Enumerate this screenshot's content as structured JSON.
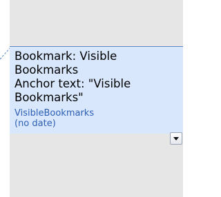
{
  "comment": {
    "text_lines": [
      "Bookmark: Visible",
      "Bookmarks",
      "Anchor text: \"Visible",
      "Bookmarks\""
    ],
    "author": "VisibleBookmarks",
    "date": "(no date)"
  },
  "icons": {
    "menu_button_icon": "triangle-down-icon"
  },
  "colors": {
    "panel_background": "#e6e6e6",
    "comment_background": "#d8e7fc",
    "comment_border": "#5b87c7",
    "author_text": "#2d5fb5",
    "connector_line": "#5b87c7"
  }
}
